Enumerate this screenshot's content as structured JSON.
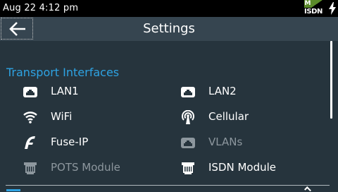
{
  "status": {
    "time": "Aug 22 4:12 pm",
    "badge_top": "M",
    "badge_bottom": "ISDN"
  },
  "header": {
    "title": "Settings"
  },
  "section": {
    "title": "Transport Interfaces"
  },
  "items": [
    {
      "label": "LAN1",
      "icon": "ethernet-icon",
      "enabled": true
    },
    {
      "label": "LAN2",
      "icon": "ethernet-icon",
      "enabled": true
    },
    {
      "label": "WiFi",
      "icon": "wifi-icon",
      "enabled": true
    },
    {
      "label": "Cellular",
      "icon": "cellular-tower-icon",
      "enabled": true
    },
    {
      "label": "Fuse-IP",
      "icon": "fuse-ip-icon",
      "enabled": true
    },
    {
      "label": "VLANs",
      "icon": "ethernet-icon",
      "enabled": false
    },
    {
      "label": "POTS Module",
      "icon": "module-connector-icon",
      "enabled": false
    },
    {
      "label": "ISDN Module",
      "icon": "module-connector-icon",
      "enabled": true
    }
  ],
  "colors": {
    "accent": "#2ea3e3",
    "background": "#26343d",
    "titlebar": "#364550",
    "disabled": "#8d979e"
  }
}
